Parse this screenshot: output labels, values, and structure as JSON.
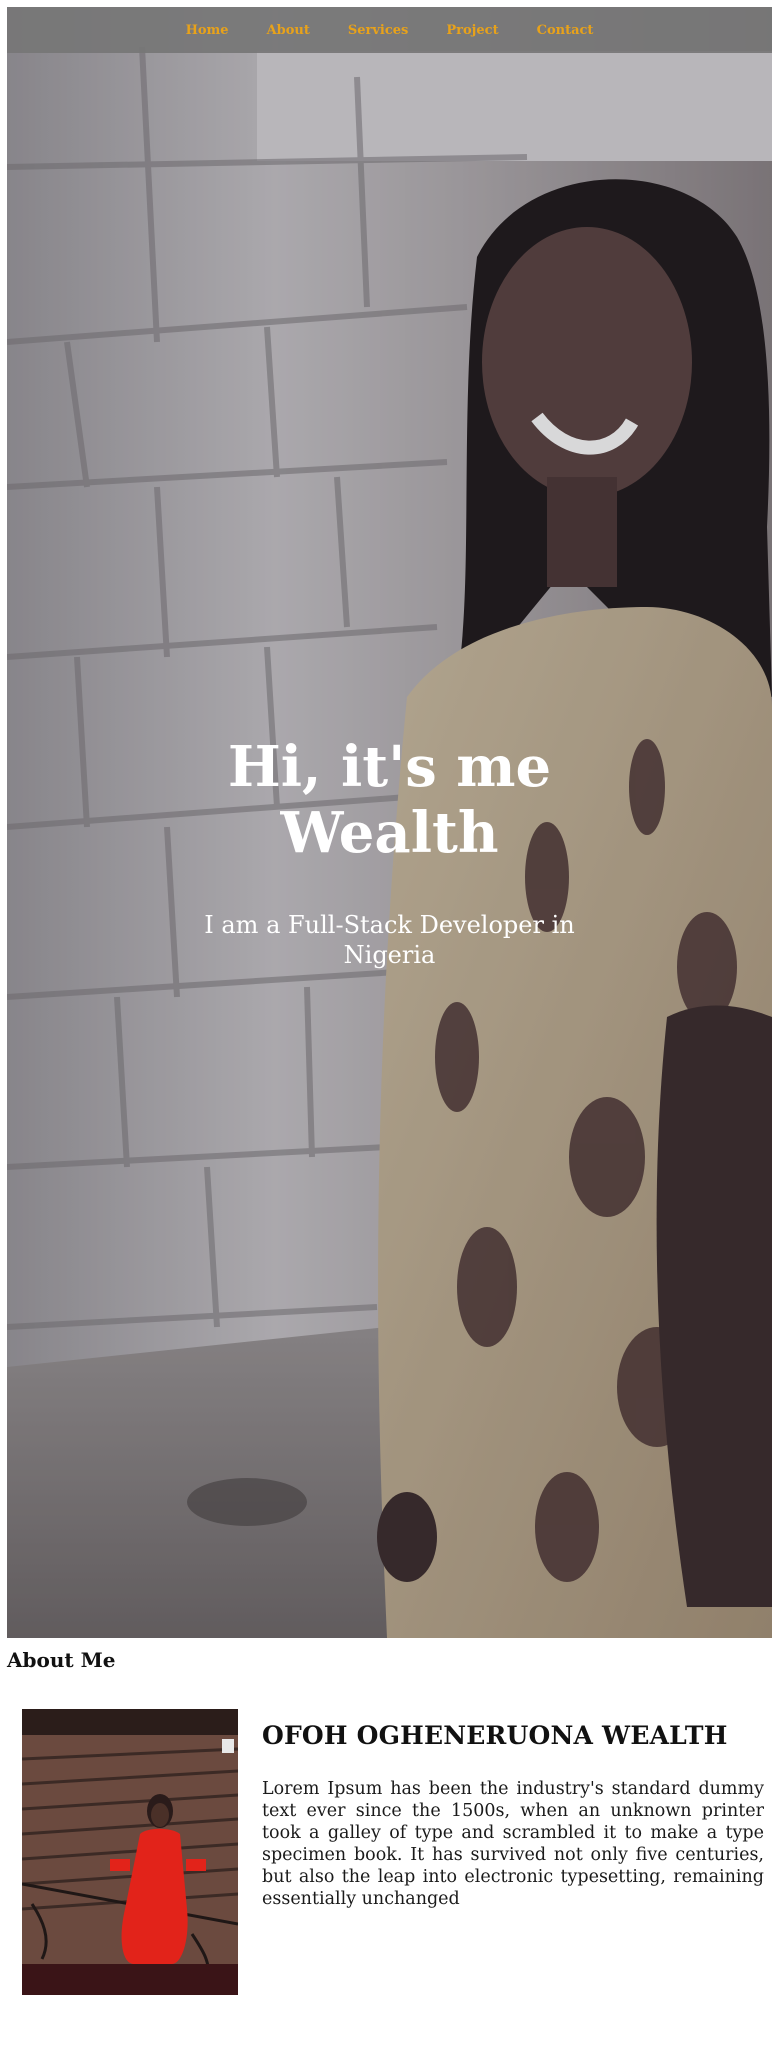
{
  "nav": {
    "items": [
      {
        "label": "Home"
      },
      {
        "label": "About"
      },
      {
        "label": "Services"
      },
      {
        "label": "Project"
      },
      {
        "label": "Contact"
      }
    ],
    "link_color": "#e8a21a",
    "bar_color": "#767676"
  },
  "hero": {
    "title": "Hi, it's me Wealth",
    "subtitle": "I am a Full-Stack Developer in Nigeria"
  },
  "about": {
    "heading": "About Me",
    "name": "OFOH OGHENERUONA WEALTH",
    "text": "Lorem Ipsum has been the industry's standard dummy text ever since the 1500s, when an unknown printer took a galley of type and scrambled it to make a type specimen book. It has survived not only five centuries, but also the leap into electronic typesetting, remaining essentially unchanged"
  }
}
